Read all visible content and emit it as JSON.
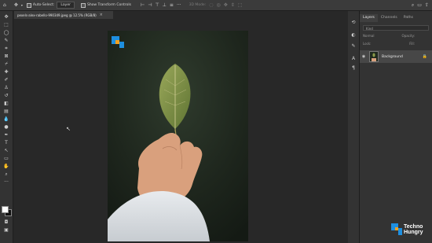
{
  "options_bar": {
    "auto_select_label": "Auto-Select:",
    "auto_select_value": "Layer",
    "transform_label": "Show Transform Controls",
    "mode_label": "3D Mode:"
  },
  "document_tab": {
    "title": "pexels-alex-rabello-990349.jpeg @ 12.5% (RGB/8)",
    "close": "×"
  },
  "layers_panel": {
    "tabs": [
      "Layers",
      "Channels",
      "Paths"
    ],
    "kind_label": "Kind",
    "blend_mode": "Normal",
    "opacity_label": "Opacity:",
    "lock_label": "Lock:",
    "fill_label": "Fill:",
    "layer_name": "Background"
  },
  "watermark": {
    "line1": "Techno",
    "line2": "Hungry",
    "accent": "#1e8fe0"
  },
  "icons": {
    "move": "✥",
    "home": "⌂",
    "cursor": "↖"
  }
}
